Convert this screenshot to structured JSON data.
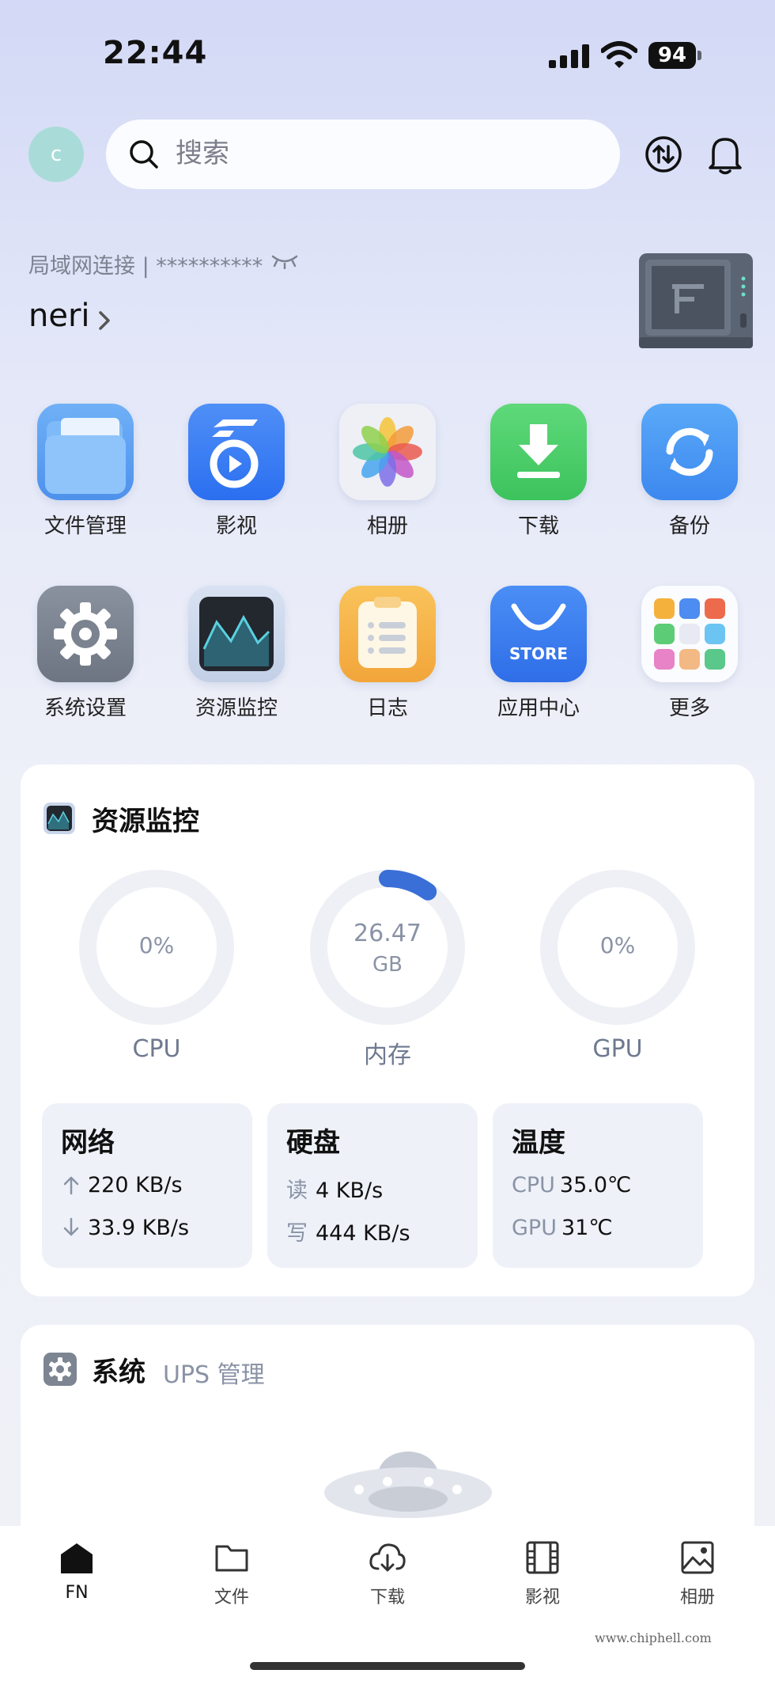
{
  "status_bar": {
    "time": "22:44",
    "battery": "94"
  },
  "header": {
    "avatar_letter": "c",
    "search_placeholder": "搜索"
  },
  "nas": {
    "connection": "局域网连接 | **********",
    "device_name": "neri"
  },
  "apps": [
    {
      "label": "文件管理",
      "icon": "folder-icon"
    },
    {
      "label": "影视",
      "icon": "video-icon"
    },
    {
      "label": "相册",
      "icon": "photos-icon"
    },
    {
      "label": "下载",
      "icon": "download-icon"
    },
    {
      "label": "备份",
      "icon": "backup-icon"
    },
    {
      "label": "系统设置",
      "icon": "gear-icon"
    },
    {
      "label": "资源监控",
      "icon": "monitor-icon"
    },
    {
      "label": "日志",
      "icon": "log-icon"
    },
    {
      "label": "应用中心",
      "icon": "store-icon"
    },
    {
      "label": "更多",
      "icon": "more-icon"
    }
  ],
  "store_text": "STORE",
  "resource_monitor": {
    "title": "资源监控",
    "cpu": {
      "label": "CPU",
      "value": "0%",
      "fraction": 0
    },
    "memory": {
      "label": "内存",
      "value": "26.47",
      "unit": "GB",
      "fraction": 0.1
    },
    "gpu": {
      "label": "GPU",
      "value": "0%",
      "fraction": 0
    },
    "network": {
      "title": "网络",
      "up": "220 KB/s",
      "down": "33.9 KB/s"
    },
    "disk": {
      "title": "硬盘",
      "read_label": "读",
      "read": "4 KB/s",
      "write_label": "写",
      "write": "444 KB/s"
    },
    "temperature": {
      "title": "温度",
      "cpu_label": "CPU",
      "cpu": "35.0℃",
      "gpu_label": "GPU",
      "gpu": "31℃"
    }
  },
  "system_card": {
    "title": "系统",
    "subtitle": "UPS 管理"
  },
  "tabs": [
    {
      "label": "FN",
      "icon": "home-icon"
    },
    {
      "label": "文件",
      "icon": "folder-outline-icon"
    },
    {
      "label": "下载",
      "icon": "cloud-download-icon"
    },
    {
      "label": "影视",
      "icon": "film-icon"
    },
    {
      "label": "相册",
      "icon": "image-icon"
    }
  ],
  "watermark": "www.chiphell.com",
  "colors": {
    "accent": "#3a6fd8",
    "gauge_track": "#eef0f5"
  }
}
